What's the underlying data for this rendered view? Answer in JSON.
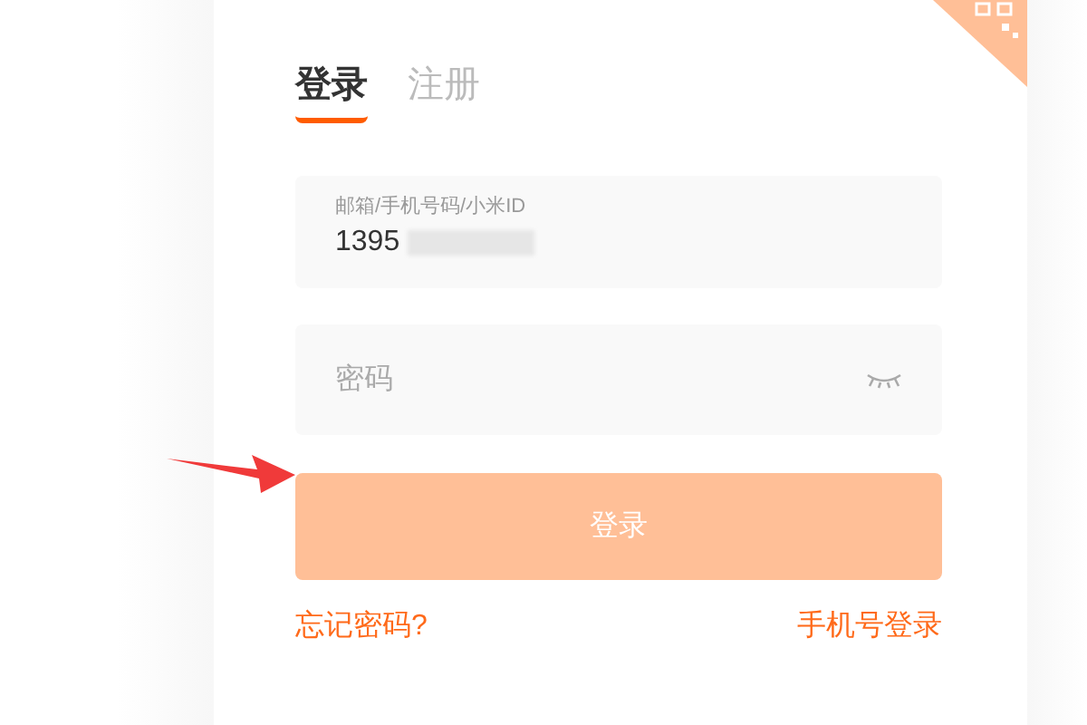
{
  "tabs": [
    {
      "label": "登录",
      "selected": true
    },
    {
      "label": "注册",
      "selected": false
    }
  ],
  "account_field": {
    "label": "邮箱/手机号码/小米ID",
    "value": "1395"
  },
  "password_field": {
    "placeholder": "密码"
  },
  "login_button": {
    "label": "登录",
    "disabled": true
  },
  "links": [
    "忘记密码?",
    "手机号登录"
  ]
}
